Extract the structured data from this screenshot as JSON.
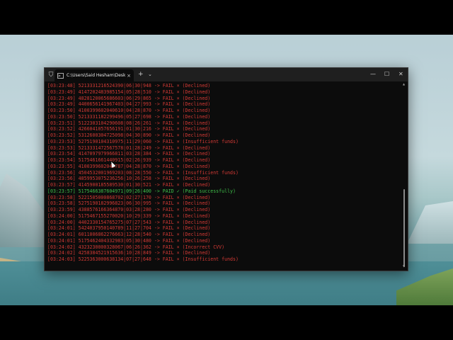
{
  "window": {
    "tab_title": "C:\\Users\\Said Hesham\\Desktc",
    "tab_icon": "terminal-icon",
    "new_tab_label": "+",
    "dropdown_label": "⌄",
    "close_tab_label": "×",
    "minimize_label": "—",
    "maximize_label": "☐",
    "close_label": "✕"
  },
  "console": {
    "lines": [
      {
        "text": "[03:23:48] 5213331216524390|06|30|948 -> FAIL × (Declined)",
        "status": "fail"
      },
      {
        "text": "[03:23:49] 4147202483985154|05|28|510 -> FAIL × (Declined)",
        "status": "fail"
      },
      {
        "text": "[03:23:49] 4828120065686603|06|29|865 -> FAIL × (Declined)",
        "status": "fail"
      },
      {
        "text": "[03:23:49] 4400656141967403|04|27|993 -> FAIL × (Declined)",
        "status": "fail"
      },
      {
        "text": "[03:23:50] 4100399602040610|04|28|870 -> FAIL × (Declined)",
        "status": "fail"
      },
      {
        "text": "[03:23:50] 5213331182299496|05|27|698 -> FAIL × (Declined)",
        "status": "fail"
      },
      {
        "text": "[03:23:51] 5122303104290608|08|26|261 -> FAIL × (Declined)",
        "status": "fail"
      },
      {
        "text": "[03:23:52] 4266041057656191|01|30|216 -> FAIL × (Declined)",
        "status": "fail"
      },
      {
        "text": "[03:23:52] 5312600304725098|04|30|890 -> FAIL × (Declined)",
        "status": "fail"
      },
      {
        "text": "[03:23:53] 5275190104310975|11|29|060 -> FAIL × (Insufficient funds)",
        "status": "fail"
      },
      {
        "text": "[03:23:53] 5213331472567578|01|28|249 -> FAIL × (Declined)",
        "status": "fail"
      },
      {
        "text": "[03:23:54] 4147097979966811|03|28|384 -> FAIL × (Declined)",
        "status": "fail"
      },
      {
        "text": "[03:23:54] 5175461661440915|02|26|939 -> FAIL × (Declined)",
        "status": "fail"
      },
      {
        "text": "[03:23:55] 4100399602040787|04|28|870 -> FAIL × (Declined)",
        "status": "fail"
      },
      {
        "text": "[03:23:56] 4504532001969203|08|28|550 -> FAIL × (Insufficient funds)",
        "status": "fail"
      },
      {
        "text": "[03:23:56] 4859953075236256|10|26|258 -> FAIL × (Declined)",
        "status": "fail"
      },
      {
        "text": "[03:23:57] 4145900185589530|01|30|521 -> FAIL × (Declined)",
        "status": "fail"
      },
      {
        "text": "[03:23:57] 5175466387604971|09|26|400 -> PAID ✓ (Paid successfully)",
        "status": "paid"
      },
      {
        "text": "[03:23:58] 5221505000868702|02|27|170 -> FAIL × (Declined)",
        "status": "fail"
      },
      {
        "text": "[03:23:58] 5275190182996823|06|30|995 -> FAIL × (Declined)",
        "status": "fail"
      },
      {
        "text": "[03:23:59] 4388576166364870|03|28|280 -> FAIL × (Declined)",
        "status": "fail"
      },
      {
        "text": "[03:24:00] 5175467155270020|10|29|339 -> FAIL × (Declined)",
        "status": "fail"
      },
      {
        "text": "[03:24:00] 4402330154765275|07|27|543 -> FAIL × (Declined)",
        "status": "fail"
      },
      {
        "text": "[03:24:01] 5424037950140789|11|27|704 -> FAIL × (Declined)",
        "status": "fail"
      },
      {
        "text": "[03:24:01] 6011006862276663|12|28|540 -> FAIL × (Declined)",
        "status": "fail"
      },
      {
        "text": "[03:24:01] 5175462404332983|05|30|480 -> FAIL × (Declined)",
        "status": "fail"
      },
      {
        "text": "[03:24:02] 4323230000328067|06|26|362 -> FAIL × (Incorrect CVV)",
        "status": "fail"
      },
      {
        "text": "[03:24:02] 4258384521915636|10|28|849 -> FAIL × (Declined)",
        "status": "fail"
      },
      {
        "text": "[03:24:03] 5225363000638134|07|27|648 -> FAIL × (Insufficient funds)",
        "status": "fail"
      }
    ]
  },
  "colors": {
    "fail": "#d33a35",
    "paid": "#3fc04a",
    "background": "#0c0c0c",
    "titlebar": "#1f1f1f"
  }
}
